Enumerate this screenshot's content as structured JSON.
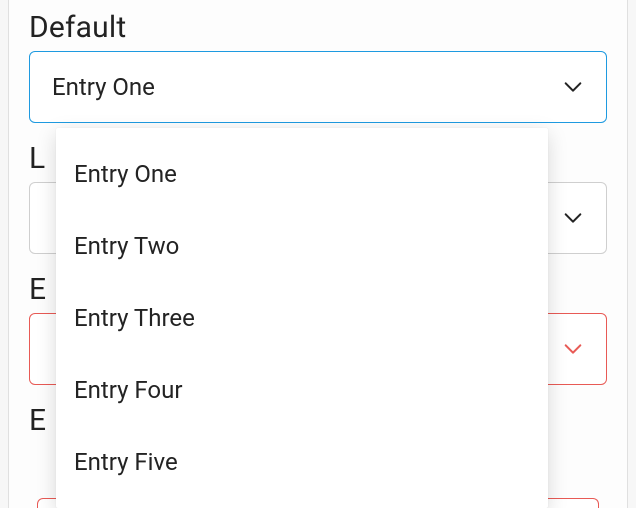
{
  "fields": [
    {
      "label": "Default",
      "selected": "Entry One",
      "state": "focused"
    },
    {
      "label": "L",
      "selected": "",
      "state": "normal"
    },
    {
      "label": "E",
      "selected": "",
      "state": "error"
    },
    {
      "label": "E",
      "selected": "",
      "state": "error-peek"
    }
  ],
  "dropdown": {
    "items": [
      "Entry One",
      "Entry Two",
      "Entry Three",
      "Entry Four",
      "Entry Five"
    ]
  }
}
